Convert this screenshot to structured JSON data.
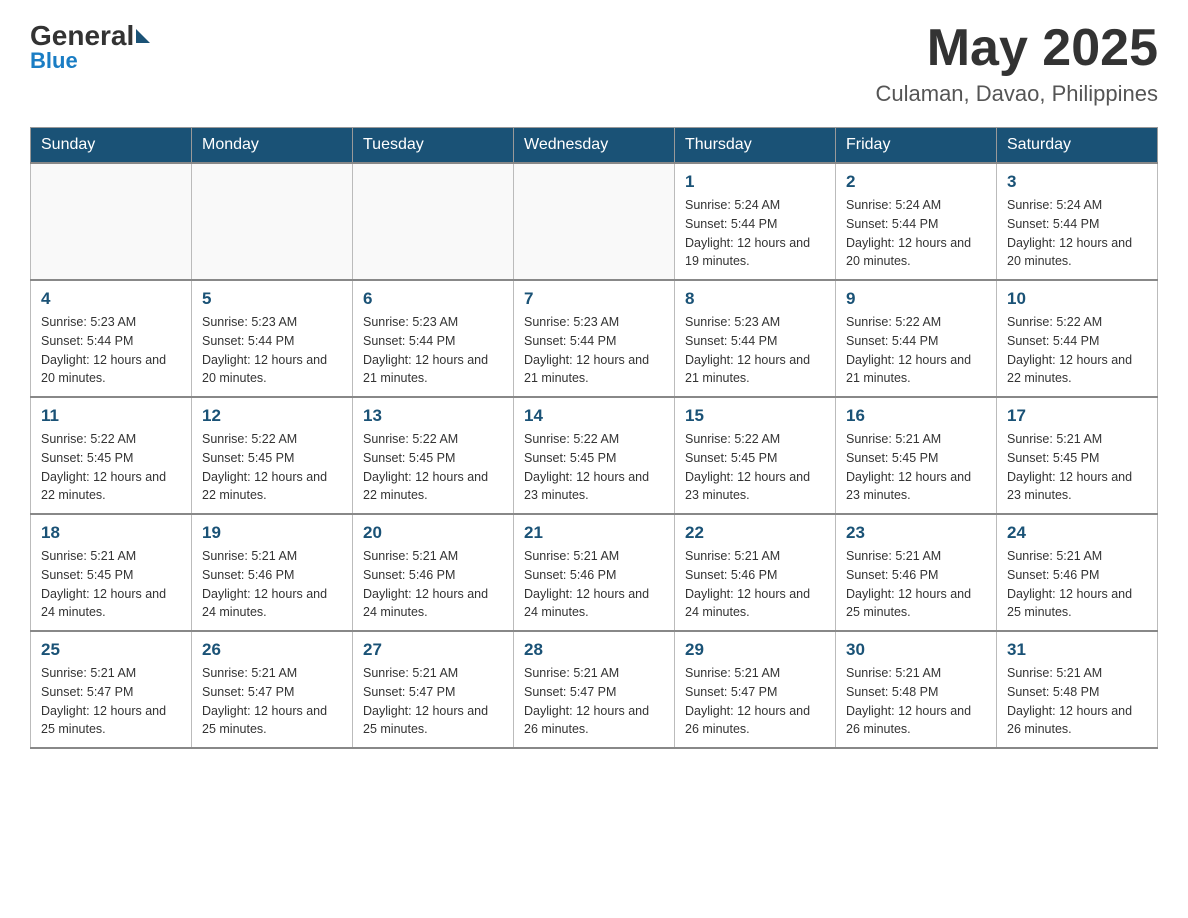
{
  "header": {
    "logo": {
      "part1": "General",
      "part2": "Blue"
    },
    "month_title": "May 2025",
    "location": "Culaman, Davao, Philippines"
  },
  "weekdays": [
    "Sunday",
    "Monday",
    "Tuesday",
    "Wednesday",
    "Thursday",
    "Friday",
    "Saturday"
  ],
  "weeks": [
    [
      {
        "day": "",
        "info": ""
      },
      {
        "day": "",
        "info": ""
      },
      {
        "day": "",
        "info": ""
      },
      {
        "day": "",
        "info": ""
      },
      {
        "day": "1",
        "info": "Sunrise: 5:24 AM\nSunset: 5:44 PM\nDaylight: 12 hours and 19 minutes."
      },
      {
        "day": "2",
        "info": "Sunrise: 5:24 AM\nSunset: 5:44 PM\nDaylight: 12 hours and 20 minutes."
      },
      {
        "day": "3",
        "info": "Sunrise: 5:24 AM\nSunset: 5:44 PM\nDaylight: 12 hours and 20 minutes."
      }
    ],
    [
      {
        "day": "4",
        "info": "Sunrise: 5:23 AM\nSunset: 5:44 PM\nDaylight: 12 hours and 20 minutes."
      },
      {
        "day": "5",
        "info": "Sunrise: 5:23 AM\nSunset: 5:44 PM\nDaylight: 12 hours and 20 minutes."
      },
      {
        "day": "6",
        "info": "Sunrise: 5:23 AM\nSunset: 5:44 PM\nDaylight: 12 hours and 21 minutes."
      },
      {
        "day": "7",
        "info": "Sunrise: 5:23 AM\nSunset: 5:44 PM\nDaylight: 12 hours and 21 minutes."
      },
      {
        "day": "8",
        "info": "Sunrise: 5:23 AM\nSunset: 5:44 PM\nDaylight: 12 hours and 21 minutes."
      },
      {
        "day": "9",
        "info": "Sunrise: 5:22 AM\nSunset: 5:44 PM\nDaylight: 12 hours and 21 minutes."
      },
      {
        "day": "10",
        "info": "Sunrise: 5:22 AM\nSunset: 5:44 PM\nDaylight: 12 hours and 22 minutes."
      }
    ],
    [
      {
        "day": "11",
        "info": "Sunrise: 5:22 AM\nSunset: 5:45 PM\nDaylight: 12 hours and 22 minutes."
      },
      {
        "day": "12",
        "info": "Sunrise: 5:22 AM\nSunset: 5:45 PM\nDaylight: 12 hours and 22 minutes."
      },
      {
        "day": "13",
        "info": "Sunrise: 5:22 AM\nSunset: 5:45 PM\nDaylight: 12 hours and 22 minutes."
      },
      {
        "day": "14",
        "info": "Sunrise: 5:22 AM\nSunset: 5:45 PM\nDaylight: 12 hours and 23 minutes."
      },
      {
        "day": "15",
        "info": "Sunrise: 5:22 AM\nSunset: 5:45 PM\nDaylight: 12 hours and 23 minutes."
      },
      {
        "day": "16",
        "info": "Sunrise: 5:21 AM\nSunset: 5:45 PM\nDaylight: 12 hours and 23 minutes."
      },
      {
        "day": "17",
        "info": "Sunrise: 5:21 AM\nSunset: 5:45 PM\nDaylight: 12 hours and 23 minutes."
      }
    ],
    [
      {
        "day": "18",
        "info": "Sunrise: 5:21 AM\nSunset: 5:45 PM\nDaylight: 12 hours and 24 minutes."
      },
      {
        "day": "19",
        "info": "Sunrise: 5:21 AM\nSunset: 5:46 PM\nDaylight: 12 hours and 24 minutes."
      },
      {
        "day": "20",
        "info": "Sunrise: 5:21 AM\nSunset: 5:46 PM\nDaylight: 12 hours and 24 minutes."
      },
      {
        "day": "21",
        "info": "Sunrise: 5:21 AM\nSunset: 5:46 PM\nDaylight: 12 hours and 24 minutes."
      },
      {
        "day": "22",
        "info": "Sunrise: 5:21 AM\nSunset: 5:46 PM\nDaylight: 12 hours and 24 minutes."
      },
      {
        "day": "23",
        "info": "Sunrise: 5:21 AM\nSunset: 5:46 PM\nDaylight: 12 hours and 25 minutes."
      },
      {
        "day": "24",
        "info": "Sunrise: 5:21 AM\nSunset: 5:46 PM\nDaylight: 12 hours and 25 minutes."
      }
    ],
    [
      {
        "day": "25",
        "info": "Sunrise: 5:21 AM\nSunset: 5:47 PM\nDaylight: 12 hours and 25 minutes."
      },
      {
        "day": "26",
        "info": "Sunrise: 5:21 AM\nSunset: 5:47 PM\nDaylight: 12 hours and 25 minutes."
      },
      {
        "day": "27",
        "info": "Sunrise: 5:21 AM\nSunset: 5:47 PM\nDaylight: 12 hours and 25 minutes."
      },
      {
        "day": "28",
        "info": "Sunrise: 5:21 AM\nSunset: 5:47 PM\nDaylight: 12 hours and 26 minutes."
      },
      {
        "day": "29",
        "info": "Sunrise: 5:21 AM\nSunset: 5:47 PM\nDaylight: 12 hours and 26 minutes."
      },
      {
        "day": "30",
        "info": "Sunrise: 5:21 AM\nSunset: 5:48 PM\nDaylight: 12 hours and 26 minutes."
      },
      {
        "day": "31",
        "info": "Sunrise: 5:21 AM\nSunset: 5:48 PM\nDaylight: 12 hours and 26 minutes."
      }
    ]
  ]
}
